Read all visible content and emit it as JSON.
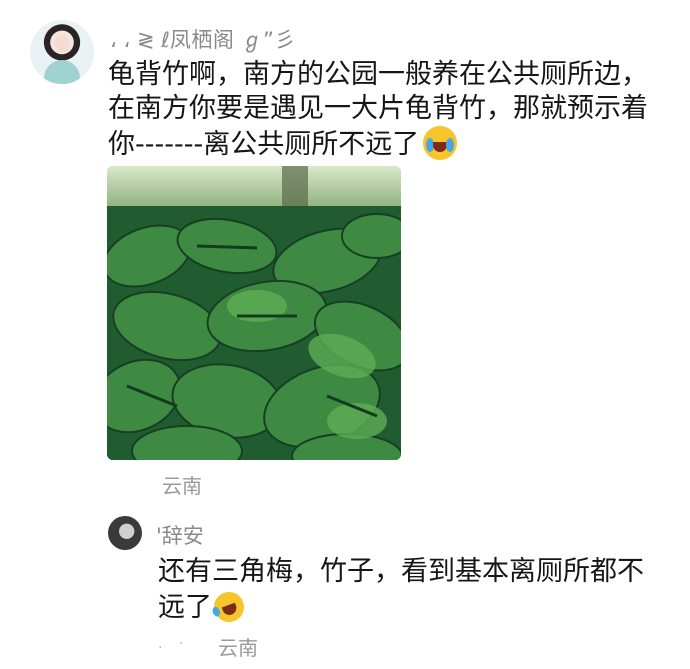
{
  "main_comment": {
    "username": "، ، ≷ ℓ凤栖阁 ℊ”彡",
    "text_line1": "龟背竹啊，南方的公园一般养在公共厕所边，",
    "text_line2": "在南方你要是遇见一大片龟背竹，那就预示着",
    "text_line3": "你-------离公共厕所不远了",
    "emoji": "crying-laughing-emoji",
    "location": "云南"
  },
  "reply": {
    "username": "'辞安",
    "text_line1": "还有三角梅，竹子，看到基本离厕所都不",
    "text_line2": "远了",
    "emoji": "rolling-laughing-emoji",
    "prefix_dots": ". ·",
    "location": "云南"
  },
  "colors": {
    "text": "#161616",
    "meta": "#9a9a9a",
    "leaf_dark": "#1f5a2e",
    "leaf_light": "#4f9a4a"
  }
}
